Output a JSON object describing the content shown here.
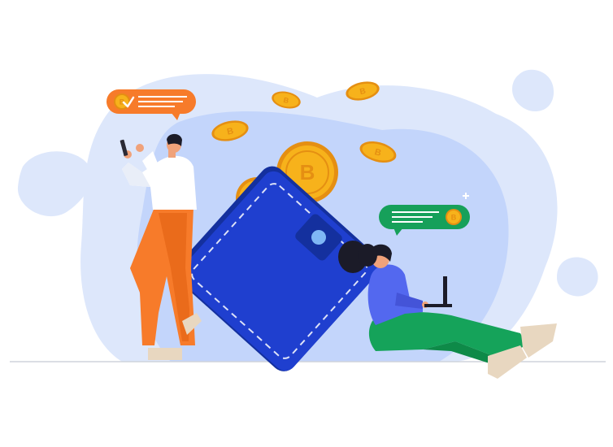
{
  "scene": {
    "description_free": true,
    "colors": {
      "background": "#ffffff",
      "blob_light": "#dde7fb",
      "blob_mid": "#c3d5fb",
      "wallet_blue": "#1f3fcf",
      "wallet_dark": "#14309e",
      "coin_gold": "#f7b21b",
      "coin_dark": "#e58f12",
      "bubble_orange": "#f77b2a",
      "bubble_green": "#16a05a",
      "man_shirt": "#ffffff",
      "man_pants": "#f77b2a",
      "woman_shirt": "#5368ef",
      "woman_pants": "#15a35a",
      "skin": "#f0a27a",
      "shoe": "#e8d7c0",
      "ground": "#cfd4dc"
    },
    "icons": [
      "bitcoin-coin-icon",
      "check-icon",
      "wallet-icon",
      "laptop-icon",
      "smartphone-icon",
      "sparkle-icon"
    ]
  }
}
